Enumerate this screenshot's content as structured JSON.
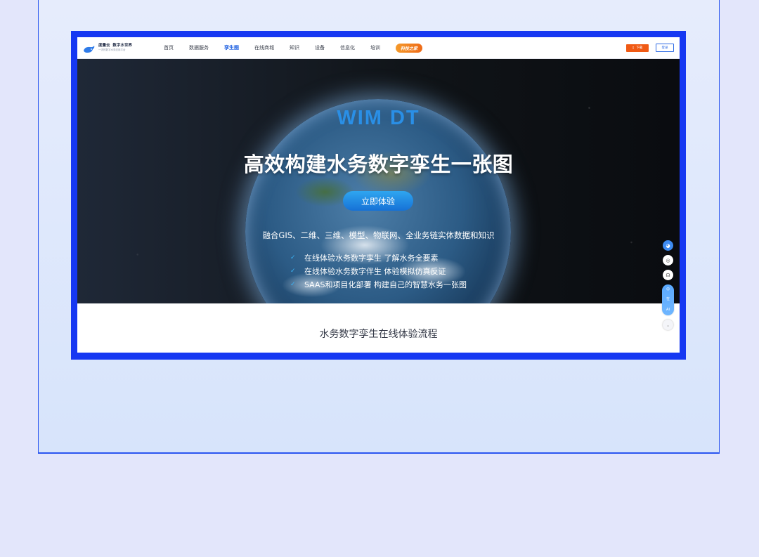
{
  "nav": {
    "logo": {
      "name": "度量云",
      "tagline": "数字水世界",
      "sub": "一流的数字水务应用平台"
    },
    "items": [
      {
        "label": "首页"
      },
      {
        "label": "数据服务"
      },
      {
        "label": "孪生图",
        "active": true
      },
      {
        "label": "在线商城"
      },
      {
        "label": "知识"
      },
      {
        "label": "设备"
      },
      {
        "label": "信息化"
      },
      {
        "label": "培训"
      }
    ],
    "promo": "科技之家",
    "download_label": "下载",
    "login_label": "登录"
  },
  "hero": {
    "brand": "WIM  DT",
    "title": "高效构建水务数字孪生一张图",
    "cta": "立即体验",
    "subtitle": "融合GIS、二维、三维、模型、物联网、全业务链实体数据和知识",
    "features": [
      "在线体验水务数字孪生 了解水务全要素",
      "在线体验水务数字伴生 体验模拟仿真反证",
      "SAAS和项目化部署 构建自己的智慧水务一张图"
    ]
  },
  "side_tools": {
    "ai_label_1": "在",
    "ai_label_2": "AI"
  },
  "section": {
    "heading": "水务数字孪生在线体验流程"
  },
  "colors": {
    "accent": "#1a5de0",
    "frame": "#1638f2",
    "cta": "#1f8de6",
    "download": "#f05a14"
  }
}
